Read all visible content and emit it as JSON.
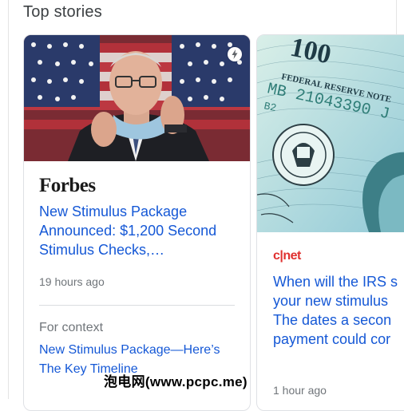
{
  "section": {
    "title": "Top stories"
  },
  "stories": [
    {
      "publisher": "Forbes",
      "headline": "New Stimulus Package Announced: $1,200 Second Stimulus Checks,…",
      "time": "19 hours ago",
      "has_amp_icon": true,
      "context": {
        "label": "For context",
        "link": "New Stimulus Package—Here’s The Key Timeline"
      }
    },
    {
      "publisher": "c|net",
      "headline_lines": [
        "When will the IRS s",
        "your new stimulus",
        "The dates a secon",
        "payment could cor"
      ],
      "time": "1 hour ago"
    }
  ],
  "watermark": "泡电网(www.pcpc.me)"
}
